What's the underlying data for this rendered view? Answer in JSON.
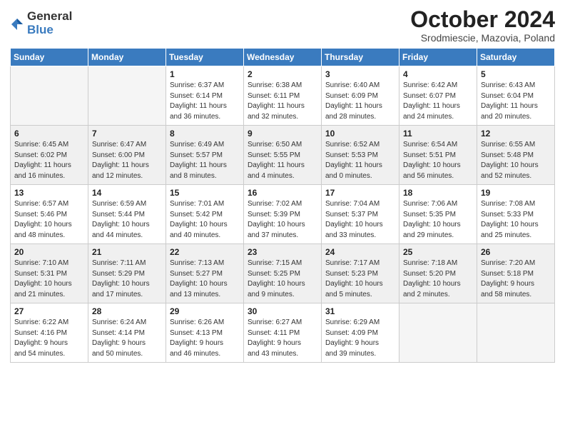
{
  "logo": {
    "general": "General",
    "blue": "Blue"
  },
  "header": {
    "month": "October 2024",
    "location": "Srodmiescie, Mazovia, Poland"
  },
  "weekdays": [
    "Sunday",
    "Monday",
    "Tuesday",
    "Wednesday",
    "Thursday",
    "Friday",
    "Saturday"
  ],
  "weeks": [
    [
      {
        "day": "",
        "info": ""
      },
      {
        "day": "",
        "info": ""
      },
      {
        "day": "1",
        "info": "Sunrise: 6:37 AM\nSunset: 6:14 PM\nDaylight: 11 hours\nand 36 minutes."
      },
      {
        "day": "2",
        "info": "Sunrise: 6:38 AM\nSunset: 6:11 PM\nDaylight: 11 hours\nand 32 minutes."
      },
      {
        "day": "3",
        "info": "Sunrise: 6:40 AM\nSunset: 6:09 PM\nDaylight: 11 hours\nand 28 minutes."
      },
      {
        "day": "4",
        "info": "Sunrise: 6:42 AM\nSunset: 6:07 PM\nDaylight: 11 hours\nand 24 minutes."
      },
      {
        "day": "5",
        "info": "Sunrise: 6:43 AM\nSunset: 6:04 PM\nDaylight: 11 hours\nand 20 minutes."
      }
    ],
    [
      {
        "day": "6",
        "info": "Sunrise: 6:45 AM\nSunset: 6:02 PM\nDaylight: 11 hours\nand 16 minutes."
      },
      {
        "day": "7",
        "info": "Sunrise: 6:47 AM\nSunset: 6:00 PM\nDaylight: 11 hours\nand 12 minutes."
      },
      {
        "day": "8",
        "info": "Sunrise: 6:49 AM\nSunset: 5:57 PM\nDaylight: 11 hours\nand 8 minutes."
      },
      {
        "day": "9",
        "info": "Sunrise: 6:50 AM\nSunset: 5:55 PM\nDaylight: 11 hours\nand 4 minutes."
      },
      {
        "day": "10",
        "info": "Sunrise: 6:52 AM\nSunset: 5:53 PM\nDaylight: 11 hours\nand 0 minutes."
      },
      {
        "day": "11",
        "info": "Sunrise: 6:54 AM\nSunset: 5:51 PM\nDaylight: 10 hours\nand 56 minutes."
      },
      {
        "day": "12",
        "info": "Sunrise: 6:55 AM\nSunset: 5:48 PM\nDaylight: 10 hours\nand 52 minutes."
      }
    ],
    [
      {
        "day": "13",
        "info": "Sunrise: 6:57 AM\nSunset: 5:46 PM\nDaylight: 10 hours\nand 48 minutes."
      },
      {
        "day": "14",
        "info": "Sunrise: 6:59 AM\nSunset: 5:44 PM\nDaylight: 10 hours\nand 44 minutes."
      },
      {
        "day": "15",
        "info": "Sunrise: 7:01 AM\nSunset: 5:42 PM\nDaylight: 10 hours\nand 40 minutes."
      },
      {
        "day": "16",
        "info": "Sunrise: 7:02 AM\nSunset: 5:39 PM\nDaylight: 10 hours\nand 37 minutes."
      },
      {
        "day": "17",
        "info": "Sunrise: 7:04 AM\nSunset: 5:37 PM\nDaylight: 10 hours\nand 33 minutes."
      },
      {
        "day": "18",
        "info": "Sunrise: 7:06 AM\nSunset: 5:35 PM\nDaylight: 10 hours\nand 29 minutes."
      },
      {
        "day": "19",
        "info": "Sunrise: 7:08 AM\nSunset: 5:33 PM\nDaylight: 10 hours\nand 25 minutes."
      }
    ],
    [
      {
        "day": "20",
        "info": "Sunrise: 7:10 AM\nSunset: 5:31 PM\nDaylight: 10 hours\nand 21 minutes."
      },
      {
        "day": "21",
        "info": "Sunrise: 7:11 AM\nSunset: 5:29 PM\nDaylight: 10 hours\nand 17 minutes."
      },
      {
        "day": "22",
        "info": "Sunrise: 7:13 AM\nSunset: 5:27 PM\nDaylight: 10 hours\nand 13 minutes."
      },
      {
        "day": "23",
        "info": "Sunrise: 7:15 AM\nSunset: 5:25 PM\nDaylight: 10 hours\nand 9 minutes."
      },
      {
        "day": "24",
        "info": "Sunrise: 7:17 AM\nSunset: 5:23 PM\nDaylight: 10 hours\nand 5 minutes."
      },
      {
        "day": "25",
        "info": "Sunrise: 7:18 AM\nSunset: 5:20 PM\nDaylight: 10 hours\nand 2 minutes."
      },
      {
        "day": "26",
        "info": "Sunrise: 7:20 AM\nSunset: 5:18 PM\nDaylight: 9 hours\nand 58 minutes."
      }
    ],
    [
      {
        "day": "27",
        "info": "Sunrise: 6:22 AM\nSunset: 4:16 PM\nDaylight: 9 hours\nand 54 minutes."
      },
      {
        "day": "28",
        "info": "Sunrise: 6:24 AM\nSunset: 4:14 PM\nDaylight: 9 hours\nand 50 minutes."
      },
      {
        "day": "29",
        "info": "Sunrise: 6:26 AM\nSunset: 4:13 PM\nDaylight: 9 hours\nand 46 minutes."
      },
      {
        "day": "30",
        "info": "Sunrise: 6:27 AM\nSunset: 4:11 PM\nDaylight: 9 hours\nand 43 minutes."
      },
      {
        "day": "31",
        "info": "Sunrise: 6:29 AM\nSunset: 4:09 PM\nDaylight: 9 hours\nand 39 minutes."
      },
      {
        "day": "",
        "info": ""
      },
      {
        "day": "",
        "info": ""
      }
    ]
  ]
}
